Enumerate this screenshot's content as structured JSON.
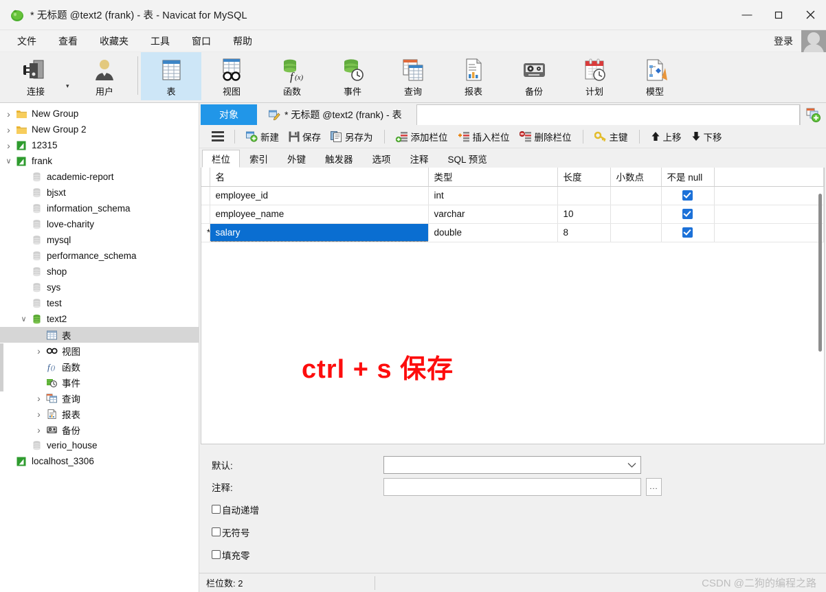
{
  "window": {
    "title": "* 无标题 @text2 (frank) - 表 - Navicat for MySQL",
    "minimize": "—",
    "maximize": "▢",
    "close": "✕"
  },
  "menubar": {
    "items": [
      "文件",
      "查看",
      "收藏夹",
      "工具",
      "窗口",
      "帮助"
    ],
    "login_label": "登录"
  },
  "toolbar": {
    "items": [
      {
        "label": "连接",
        "icon": "connection-icon"
      },
      {
        "label": "用户",
        "icon": "user-icon"
      },
      {
        "label": "表",
        "icon": "table-icon"
      },
      {
        "label": "视图",
        "icon": "view-icon"
      },
      {
        "label": "函数",
        "icon": "function-icon"
      },
      {
        "label": "事件",
        "icon": "event-icon"
      },
      {
        "label": "查询",
        "icon": "query-icon"
      },
      {
        "label": "报表",
        "icon": "report-icon"
      },
      {
        "label": "备份",
        "icon": "backup-icon"
      },
      {
        "label": "计划",
        "icon": "schedule-icon"
      },
      {
        "label": "模型",
        "icon": "model-icon"
      }
    ],
    "active": "表"
  },
  "sidebar": {
    "items": [
      {
        "label": "New Group",
        "icon": "folder-icon",
        "indent": 0,
        "arrow": "right",
        "selected": false
      },
      {
        "label": "New Group 2",
        "icon": "folder-icon",
        "indent": 0,
        "arrow": "right",
        "selected": false
      },
      {
        "label": "12315",
        "icon": "connection-icon",
        "indent": 0,
        "arrow": "right",
        "selected": false
      },
      {
        "label": "frank",
        "icon": "connection-icon",
        "indent": 0,
        "arrow": "down",
        "selected": false
      },
      {
        "label": "academic-report",
        "icon": "database-icon",
        "indent": 1,
        "arrow": "none",
        "selected": false
      },
      {
        "label": "bjsxt",
        "icon": "database-icon",
        "indent": 1,
        "arrow": "none",
        "selected": false
      },
      {
        "label": "information_schema",
        "icon": "database-icon",
        "indent": 1,
        "arrow": "none",
        "selected": false
      },
      {
        "label": "love-charity",
        "icon": "database-icon",
        "indent": 1,
        "arrow": "none",
        "selected": false
      },
      {
        "label": "mysql",
        "icon": "database-icon",
        "indent": 1,
        "arrow": "none",
        "selected": false
      },
      {
        "label": "performance_schema",
        "icon": "database-icon",
        "indent": 1,
        "arrow": "none",
        "selected": false
      },
      {
        "label": "shop",
        "icon": "database-icon",
        "indent": 1,
        "arrow": "none",
        "selected": false
      },
      {
        "label": "sys",
        "icon": "database-icon",
        "indent": 1,
        "arrow": "none",
        "selected": false
      },
      {
        "label": "test",
        "icon": "database-icon",
        "indent": 1,
        "arrow": "none",
        "selected": false
      },
      {
        "label": "text2",
        "icon": "database-open-icon",
        "indent": 1,
        "arrow": "down",
        "selected": false
      },
      {
        "label": "表",
        "icon": "table-icon",
        "indent": 2,
        "arrow": "none",
        "selected": true
      },
      {
        "label": "视图",
        "icon": "view-icon",
        "indent": 2,
        "arrow": "right",
        "selected": false
      },
      {
        "label": "函数",
        "icon": "function-icon",
        "indent": 2,
        "arrow": "none",
        "selected": false
      },
      {
        "label": "事件",
        "icon": "event-icon",
        "indent": 2,
        "arrow": "none",
        "selected": false
      },
      {
        "label": "查询",
        "icon": "query-icon",
        "indent": 2,
        "arrow": "right",
        "selected": false
      },
      {
        "label": "报表",
        "icon": "report-icon",
        "indent": 2,
        "arrow": "right",
        "selected": false
      },
      {
        "label": "备份",
        "icon": "backup-icon",
        "indent": 2,
        "arrow": "right",
        "selected": false
      },
      {
        "label": "verio_house",
        "icon": "database-icon",
        "indent": 1,
        "arrow": "none",
        "selected": false
      },
      {
        "label": "localhost_3306",
        "icon": "connection-icon",
        "indent": 0,
        "arrow": "none",
        "selected": false
      }
    ]
  },
  "tabs": {
    "object_tab": "对象",
    "document_tab": "* 无标题 @text2 (frank) - 表",
    "add_tab_icon": "new-tab-icon"
  },
  "subtoolbar": {
    "menu_icon": "hamburger-icon",
    "buttons": [
      {
        "label": "新建",
        "icon": "new-icon"
      },
      {
        "label": "保存",
        "icon": "save-icon"
      },
      {
        "label": "另存为",
        "icon": "save-as-icon"
      },
      {
        "label": "添加栏位",
        "icon": "add-field-icon"
      },
      {
        "label": "插入栏位",
        "icon": "insert-field-icon"
      },
      {
        "label": "删除栏位",
        "icon": "delete-field-icon"
      },
      {
        "label": "主键",
        "icon": "key-icon"
      },
      {
        "label": "上移",
        "icon": "arrow-up-icon"
      },
      {
        "label": "下移",
        "icon": "arrow-down-icon"
      }
    ]
  },
  "section_tabs": {
    "items": [
      "栏位",
      "索引",
      "外键",
      "触发器",
      "选项",
      "注释",
      "SQL 预览"
    ],
    "active": "栏位"
  },
  "grid": {
    "columns": [
      "名",
      "类型",
      "长度",
      "小数点",
      "不是 null",
      ""
    ],
    "rows": [
      {
        "marker": "",
        "name": "employee_id",
        "type": "int",
        "length": "",
        "decimals": "",
        "not_null": true,
        "editing": false
      },
      {
        "marker": "",
        "name": "employee_name",
        "type": "varchar",
        "length": "10",
        "decimals": "",
        "not_null": true,
        "editing": false
      },
      {
        "marker": "*",
        "name": "salary",
        "type": "double",
        "length": "8",
        "decimals": "",
        "not_null": true,
        "editing": true
      }
    ]
  },
  "annotation": {
    "text": "ctrl + s 保存",
    "color": "#fd0d0d"
  },
  "properties": {
    "default_label": "默认:",
    "default_value": "",
    "comment_label": "注释:",
    "comment_value": "",
    "dots_button": "...",
    "checkboxes": [
      {
        "label": "自动递增",
        "checked": false
      },
      {
        "label": "无符号",
        "checked": false
      },
      {
        "label": "填充零",
        "checked": false
      }
    ]
  },
  "statusbar": {
    "field_count": "栏位数: 2",
    "watermark": "CSDN @二狗的编程之路"
  }
}
